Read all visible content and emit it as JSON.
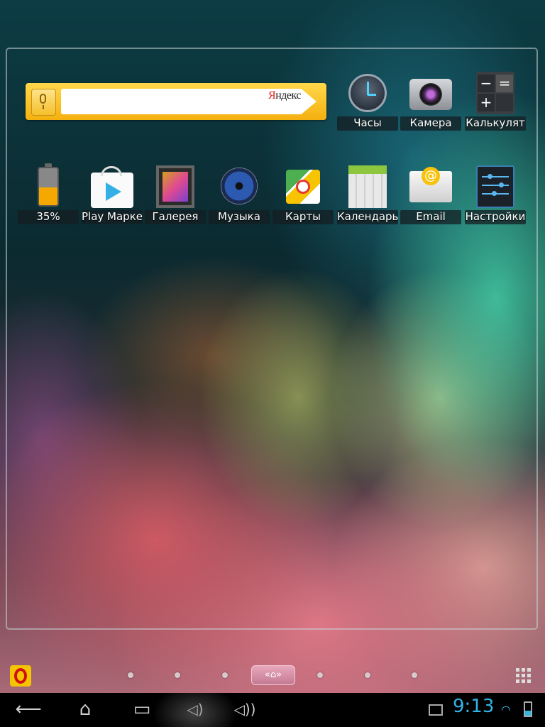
{
  "search_widget": {
    "brand_first": "Я",
    "brand_rest": "ндекс",
    "placeholder": ""
  },
  "top_apps": [
    {
      "label": "Часы",
      "icon": "clock-icon"
    },
    {
      "label": "Камера",
      "icon": "camera-icon"
    },
    {
      "label": "Калькулят",
      "icon": "calculator-icon"
    }
  ],
  "row_apps": [
    {
      "label": "35%",
      "icon": "battery-widget-icon"
    },
    {
      "label": "Play Марке",
      "icon": "play-market-icon"
    },
    {
      "label": "Галерея",
      "icon": "gallery-icon"
    },
    {
      "label": "Музыка",
      "icon": "music-icon"
    },
    {
      "label": "Карты",
      "icon": "maps-icon"
    },
    {
      "label": "Календарь",
      "icon": "calendar-icon"
    },
    {
      "label": "Email",
      "icon": "email-icon"
    },
    {
      "label": "Настройки",
      "icon": "settings-icon"
    }
  ],
  "battery_level_percent": 35,
  "calculator_symbols": [
    "−",
    "=",
    "+",
    ""
  ],
  "home_indicator": "«⌂»",
  "status": {
    "time": "9:13",
    "accent_color": "#33b5e5"
  },
  "nav": {
    "back": "⟵",
    "home": "⌂",
    "recents": "▭",
    "vol_down": "◁)",
    "vol_up": "◁))"
  }
}
